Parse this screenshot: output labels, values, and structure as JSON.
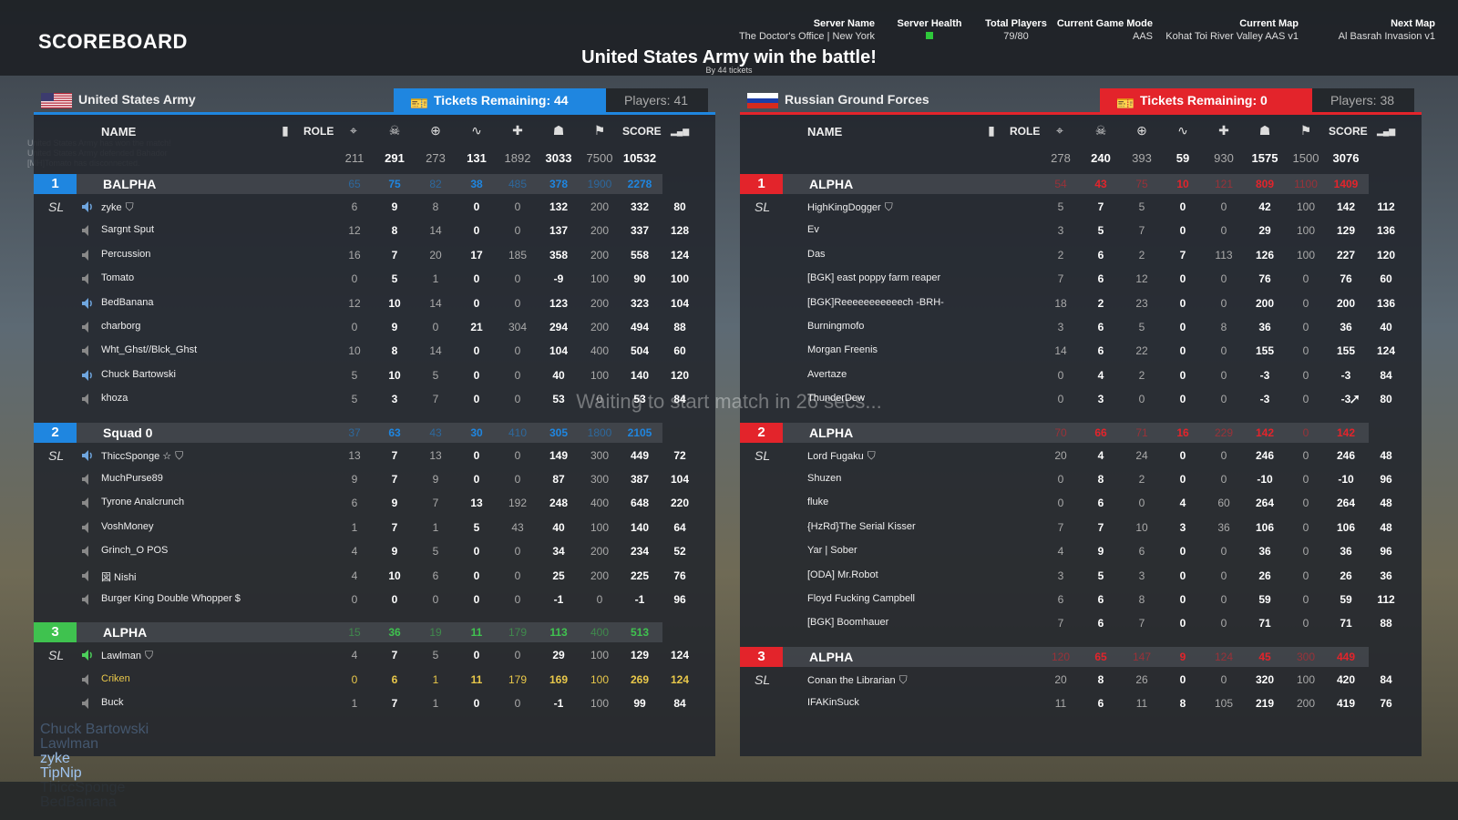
{
  "header": {
    "title": "SCOREBOARD",
    "server_name_label": "Server Name",
    "server_name": "The Doctor's Office | New York",
    "server_health_label": "Server Health",
    "total_players_label": "Total Players",
    "total_players": "79/80",
    "game_mode_label": "Current Game Mode",
    "game_mode": "AAS",
    "current_map_label": "Current Map",
    "current_map": "Kohat Toi River Valley AAS v1",
    "next_map_label": "Next Map",
    "next_map": "Al Basrah Invasion v1",
    "winner": "United States Army win the battle!",
    "winner_sub": "By 44 tickets"
  },
  "waiting_text": "Waiting to start match in 26 secs...",
  "killfeed": [
    "United States Army has won the match!",
    "United States Army defended Bahador",
    "[MH]Tomato has disconnected."
  ],
  "chat": [
    {
      "name": "Chuck Bartowski",
      "bright": false
    },
    {
      "name": "Lawlman",
      "bright": false
    },
    {
      "name": "zyke",
      "bright": true
    },
    {
      "name": "TipNip",
      "bright": true
    },
    {
      "name": "ThiccSponge",
      "bright": false
    },
    {
      "name": "BedBanana",
      "bright": false
    }
  ],
  "columns": {
    "name": "NAME",
    "role": "ROLE",
    "score": "SCORE"
  },
  "colors": {
    "us_blue": "#1f86e0",
    "ru_red": "#e3242b",
    "alpha_green": "#3fc24f"
  },
  "teams": [
    {
      "key": "us",
      "name": "United States Army",
      "tickets": "Tickets Remaining: 44",
      "players": "Players: 41",
      "totals": [
        "211",
        "291",
        "273",
        "131",
        "1892",
        "3033",
        "7500",
        "10532"
      ],
      "squads": [
        {
          "num": "1",
          "name": "BALPHA",
          "color": "#1f86e0",
          "stats": [
            "65",
            "75",
            "82",
            "38",
            "485",
            "378",
            "1900",
            "2278"
          ],
          "players": [
            {
              "sl": "SL",
              "spk": "on",
              "name": "zyke",
              "rank": true,
              "stats": [
                "6",
                "9",
                "8",
                "0",
                "0",
                "132",
                "200",
                "332",
                "80"
              ]
            },
            {
              "sl": "",
              "spk": "off",
              "name": "Sargnt Sput",
              "rank": false,
              "stats": [
                "12",
                "8",
                "14",
                "0",
                "0",
                "137",
                "200",
                "337",
                "128"
              ]
            },
            {
              "sl": "",
              "spk": "off",
              "name": "Percussion",
              "rank": false,
              "stats": [
                "16",
                "7",
                "20",
                "17",
                "185",
                "358",
                "200",
                "558",
                "124"
              ]
            },
            {
              "sl": "",
              "spk": "off",
              "name": "Tomato",
              "rank": false,
              "stats": [
                "0",
                "5",
                "1",
                "0",
                "0",
                "-9",
                "100",
                "90",
                "100"
              ]
            },
            {
              "sl": "",
              "spk": "on",
              "name": "BedBanana",
              "rank": false,
              "stats": [
                "12",
                "10",
                "14",
                "0",
                "0",
                "123",
                "200",
                "323",
                "104"
              ]
            },
            {
              "sl": "",
              "spk": "off",
              "name": "charborg",
              "rank": false,
              "stats": [
                "0",
                "9",
                "0",
                "21",
                "304",
                "294",
                "200",
                "494",
                "88"
              ]
            },
            {
              "sl": "",
              "spk": "off",
              "name": "Wht_Ghst//Blck_Ghst",
              "rank": false,
              "stats": [
                "10",
                "8",
                "14",
                "0",
                "0",
                "104",
                "400",
                "504",
                "60"
              ]
            },
            {
              "sl": "",
              "spk": "on",
              "name": "Chuck Bartowski",
              "rank": false,
              "stats": [
                "5",
                "10",
                "5",
                "0",
                "0",
                "40",
                "100",
                "140",
                "120"
              ]
            },
            {
              "sl": "",
              "spk": "off",
              "name": "khoza",
              "rank": false,
              "stats": [
                "5",
                "3",
                "7",
                "0",
                "0",
                "53",
                "0",
                "53",
                "84"
              ]
            }
          ]
        },
        {
          "num": "2",
          "name": "Squad 0",
          "color": "#1f86e0",
          "stats": [
            "37",
            "63",
            "43",
            "30",
            "410",
            "305",
            "1800",
            "2105"
          ],
          "players": [
            {
              "sl": "SL",
              "spk": "on",
              "name": "ThiccSponge ☆",
              "rank": true,
              "stats": [
                "13",
                "7",
                "13",
                "0",
                "0",
                "149",
                "300",
                "449",
                "72"
              ]
            },
            {
              "sl": "",
              "spk": "off",
              "name": "MuchPurse89",
              "rank": false,
              "stats": [
                "9",
                "7",
                "9",
                "0",
                "0",
                "87",
                "300",
                "387",
                "104"
              ]
            },
            {
              "sl": "",
              "spk": "off",
              "name": "Tyrone Analcrunch",
              "rank": false,
              "stats": [
                "6",
                "9",
                "7",
                "13",
                "192",
                "248",
                "400",
                "648",
                "220"
              ]
            },
            {
              "sl": "",
              "spk": "off",
              "name": "VoshMoney",
              "rank": false,
              "stats": [
                "1",
                "7",
                "1",
                "5",
                "43",
                "40",
                "100",
                "140",
                "64"
              ]
            },
            {
              "sl": "",
              "spk": "off",
              "name": "Grinch_O POS",
              "rank": false,
              "stats": [
                "4",
                "9",
                "5",
                "0",
                "0",
                "34",
                "200",
                "234",
                "52"
              ]
            },
            {
              "sl": "",
              "spk": "off",
              "name": "図 Nishi",
              "rank": false,
              "stats": [
                "4",
                "10",
                "6",
                "0",
                "0",
                "25",
                "200",
                "225",
                "76"
              ]
            },
            {
              "sl": "",
              "spk": "off",
              "name": "Burger King Double Whopper $",
              "rank": false,
              "stats": [
                "0",
                "0",
                "0",
                "0",
                "0",
                "-1",
                "0",
                "-1",
                "96"
              ]
            }
          ]
        },
        {
          "num": "3",
          "name": "ALPHA",
          "color": "#3fc24f",
          "stats": [
            "15",
            "36",
            "19",
            "11",
            "179",
            "113",
            "400",
            "513"
          ],
          "players": [
            {
              "sl": "SL",
              "spk": "green",
              "name": "Lawlman",
              "rank": true,
              "stats": [
                "4",
                "7",
                "5",
                "0",
                "0",
                "29",
                "100",
                "129",
                "124"
              ]
            },
            {
              "sl": "",
              "spk": "off",
              "name": "Criken",
              "rank": false,
              "yellow": true,
              "stats": [
                "0",
                "6",
                "1",
                "11",
                "179",
                "169",
                "100",
                "269",
                "124"
              ]
            },
            {
              "sl": "",
              "spk": "off",
              "name": "Buck",
              "rank": false,
              "stats": [
                "1",
                "7",
                "1",
                "0",
                "0",
                "-1",
                "100",
                "99",
                "84"
              ]
            }
          ]
        }
      ]
    },
    {
      "key": "ru",
      "name": "Russian Ground Forces",
      "tickets": "Tickets Remaining: 0",
      "players": "Players: 38",
      "totals": [
        "278",
        "240",
        "393",
        "59",
        "930",
        "1575",
        "1500",
        "3076"
      ],
      "squads": [
        {
          "num": "1",
          "name": "ALPHA",
          "color": "#e3242b",
          "stats": [
            "54",
            "43",
            "75",
            "10",
            "121",
            "809",
            "1100",
            "1409"
          ],
          "players": [
            {
              "sl": "SL",
              "spk": "none",
              "name": "HighKingDogger",
              "rank": true,
              "stats": [
                "5",
                "7",
                "5",
                "0",
                "0",
                "42",
                "100",
                "142",
                "112"
              ]
            },
            {
              "sl": "",
              "spk": "none",
              "name": "Ev",
              "rank": false,
              "stats": [
                "3",
                "5",
                "7",
                "0",
                "0",
                "29",
                "100",
                "129",
                "136"
              ]
            },
            {
              "sl": "",
              "spk": "none",
              "name": "Das",
              "rank": false,
              "stats": [
                "2",
                "6",
                "2",
                "7",
                "113",
                "126",
                "100",
                "227",
                "120"
              ]
            },
            {
              "sl": "",
              "spk": "none",
              "name": "[BGK] east poppy farm reaper",
              "rank": false,
              "stats": [
                "7",
                "6",
                "12",
                "0",
                "0",
                "76",
                "0",
                "76",
                "60"
              ]
            },
            {
              "sl": "",
              "spk": "none",
              "name": "[BGK]Reeeeeeeeeeech -BRH-",
              "rank": false,
              "stats": [
                "18",
                "2",
                "23",
                "0",
                "0",
                "200",
                "0",
                "200",
                "136"
              ]
            },
            {
              "sl": "",
              "spk": "none",
              "name": "Burningmofo",
              "rank": false,
              "stats": [
                "3",
                "6",
                "5",
                "0",
                "8",
                "36",
                "0",
                "36",
                "40"
              ]
            },
            {
              "sl": "",
              "spk": "none",
              "name": "Morgan Freenis",
              "rank": false,
              "stats": [
                "14",
                "6",
                "22",
                "0",
                "0",
                "155",
                "0",
                "155",
                "124"
              ]
            },
            {
              "sl": "",
              "spk": "none",
              "name": "Avertaze",
              "rank": false,
              "stats": [
                "0",
                "4",
                "2",
                "0",
                "0",
                "-3",
                "0",
                "-3",
                "84"
              ]
            },
            {
              "sl": "",
              "spk": "none",
              "name": "ThunderDew",
              "rank": false,
              "stats": [
                "0",
                "3",
                "0",
                "0",
                "0",
                "-3",
                "0",
                "-3",
                "80"
              ]
            }
          ]
        },
        {
          "num": "2",
          "name": "ALPHA",
          "color": "#e3242b",
          "stats": [
            "70",
            "66",
            "71",
            "16",
            "229",
            "142",
            "0",
            "142"
          ],
          "players": [
            {
              "sl": "SL",
              "spk": "none",
              "name": "Lord Fugaku",
              "rank": true,
              "stats": [
                "20",
                "4",
                "24",
                "0",
                "0",
                "246",
                "0",
                "246",
                "48"
              ]
            },
            {
              "sl": "",
              "spk": "none",
              "name": "Shuzen",
              "rank": false,
              "stats": [
                "0",
                "8",
                "2",
                "0",
                "0",
                "-10",
                "0",
                "-10",
                "96"
              ]
            },
            {
              "sl": "",
              "spk": "none",
              "name": "fluke",
              "rank": false,
              "stats": [
                "0",
                "6",
                "0",
                "4",
                "60",
                "264",
                "0",
                "264",
                "48"
              ]
            },
            {
              "sl": "",
              "spk": "none",
              "name": "{HzRd}The Serial Kisser",
              "rank": false,
              "stats": [
                "7",
                "7",
                "10",
                "3",
                "36",
                "106",
                "0",
                "106",
                "48"
              ]
            },
            {
              "sl": "",
              "spk": "none",
              "name": "Yar | Sober",
              "rank": false,
              "stats": [
                "4",
                "9",
                "6",
                "0",
                "0",
                "36",
                "0",
                "36",
                "96"
              ]
            },
            {
              "sl": "",
              "spk": "none",
              "name": "[ODA] Mr.Robot",
              "rank": false,
              "stats": [
                "3",
                "5",
                "3",
                "0",
                "0",
                "26",
                "0",
                "26",
                "36"
              ]
            },
            {
              "sl": "",
              "spk": "none",
              "name": "Floyd Fucking Campbell",
              "rank": false,
              "stats": [
                "6",
                "6",
                "8",
                "0",
                "0",
                "59",
                "0",
                "59",
                "112"
              ]
            },
            {
              "sl": "",
              "spk": "none",
              "name": "[BGK] Boomhauer",
              "rank": false,
              "stats": [
                "7",
                "6",
                "7",
                "0",
                "0",
                "71",
                "0",
                "71",
                "88"
              ]
            }
          ]
        },
        {
          "num": "3",
          "name": "ALPHA",
          "color": "#e3242b",
          "stats": [
            "120",
            "65",
            "147",
            "9",
            "124",
            "45",
            "300",
            "449"
          ],
          "players": [
            {
              "sl": "SL",
              "spk": "none",
              "name": "Conan the Librarian",
              "rank": true,
              "stats": [
                "20",
                "8",
                "26",
                "0",
                "0",
                "320",
                "100",
                "420",
                "84"
              ]
            },
            {
              "sl": "",
              "spk": "none",
              "name": "IFAKinSuck",
              "rank": false,
              "stats": [
                "11",
                "6",
                "11",
                "8",
                "105",
                "219",
                "200",
                "419",
                "76"
              ]
            }
          ]
        }
      ]
    }
  ]
}
